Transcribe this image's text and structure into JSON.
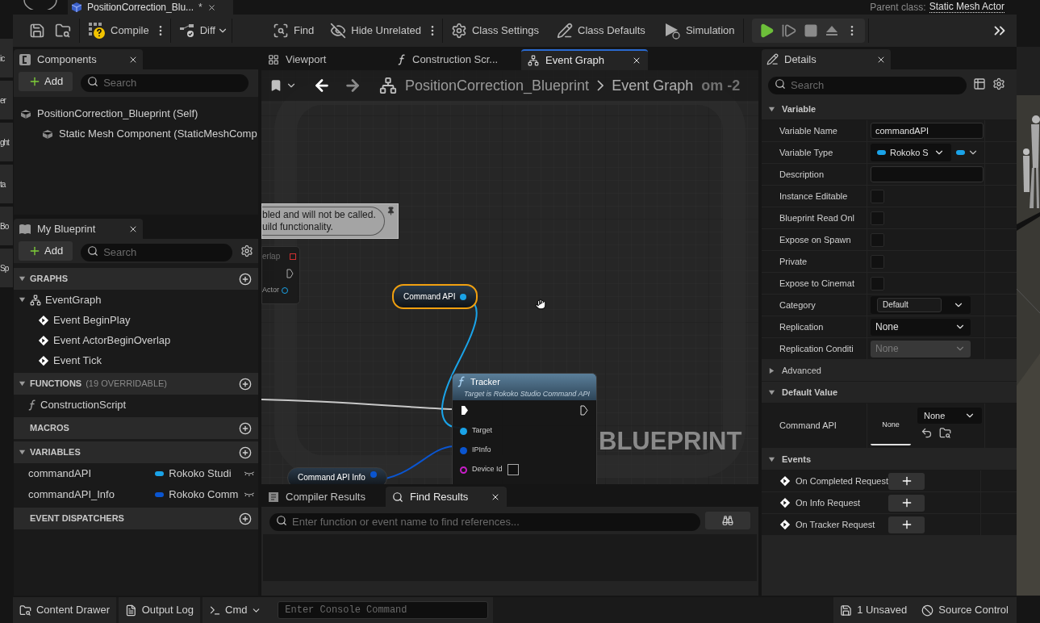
{
  "background_window": {
    "labels": [
      "ic",
      "er",
      "ght",
      "ta",
      "Bo",
      "Sp"
    ]
  },
  "document_tab": {
    "title": "PositionCorrection_Blu...",
    "modified_mark": "*"
  },
  "parent_class": {
    "label": "Parent class:",
    "value": "Static Mesh Actor"
  },
  "toolbar": {
    "compile": "Compile",
    "diff": "Diff",
    "find": "Find",
    "hide_unrelated": "Hide Unrelated",
    "class_settings": "Class Settings",
    "class_defaults": "Class Defaults",
    "simulation": "Simulation"
  },
  "components": {
    "tab": "Components",
    "add": "Add",
    "search_placeholder": "Search",
    "tree": [
      {
        "label": "PositionCorrection_Blueprint (Self)",
        "children": [
          {
            "label": "Static Mesh Component (StaticMeshComp"
          }
        ]
      }
    ]
  },
  "my_blueprint": {
    "tab": "My Blueprint",
    "add": "Add",
    "search_placeholder": "Search",
    "sections": [
      {
        "title": "GRAPHS",
        "expanded": true,
        "items": [
          {
            "kind": "graph",
            "label": "EventGraph",
            "expanded": true,
            "children": [
              {
                "kind": "event",
                "label": "Event BeginPlay"
              },
              {
                "kind": "event",
                "label": "Event ActorBeginOverlap"
              },
              {
                "kind": "event",
                "label": "Event Tick"
              }
            ]
          }
        ]
      },
      {
        "title": "FUNCTIONS",
        "note": "(19 OVERRIDABLE)",
        "expanded": true,
        "items": [
          {
            "kind": "function",
            "label": "ConstructionScript"
          }
        ]
      },
      {
        "title": "MACROS"
      },
      {
        "title": "VARIABLES",
        "expanded": true,
        "items": [
          {
            "kind": "variable",
            "label": "commandAPI",
            "type": "Rokoko Studi",
            "color": "#1aa3e8"
          },
          {
            "kind": "variable",
            "label": "commandAPI_Info",
            "type": "Rokoko Comm",
            "color": "#0a55d0"
          }
        ]
      },
      {
        "title": "EVENT DISPATCHERS"
      }
    ]
  },
  "graph_tabs": [
    {
      "label": "Viewport",
      "kind": "viewport",
      "selected": false
    },
    {
      "label": "Construction Scr...",
      "kind": "function",
      "selected": false
    },
    {
      "label": "Event Graph",
      "kind": "graph",
      "selected": true
    }
  ],
  "breadcrumb": {
    "items": [
      "PositionCorrection_Blueprint",
      "Event Graph"
    ],
    "zoom": "om -2"
  },
  "graph": {
    "comment": {
      "lines": [
        "bled and will not be called.",
        "uild functionality."
      ]
    },
    "overlap_node": {
      "title": "erlap",
      "pin": "Actor"
    },
    "variable_nodes": [
      {
        "label": "Command API",
        "selected": true,
        "color": "#1aa3e8"
      },
      {
        "label": "Command API Info",
        "selected": false,
        "color": "#0a55d0"
      }
    ],
    "function_node": {
      "title": "Tracker",
      "subtitle": "Target is Rokoko Studio Command API",
      "pins": [
        {
          "kind": "object",
          "label": "Target",
          "color": "#1aa3e8"
        },
        {
          "kind": "object",
          "label": "IPInfo",
          "color": "#0a55d0"
        },
        {
          "kind": "checkbox",
          "label": "Device Id",
          "color": "#c81ec8",
          "checked": false
        }
      ]
    },
    "watermark": "BLUEPRINT"
  },
  "bottom_panel": {
    "tabs": [
      {
        "label": "Compiler Results",
        "selected": false
      },
      {
        "label": "Find Results",
        "selected": true
      }
    ],
    "search_placeholder": "Enter function or event name to find references..."
  },
  "details": {
    "tab": "Details",
    "search_placeholder": "Search",
    "sections": [
      {
        "title": "Variable",
        "expanded": true,
        "rows": [
          {
            "kind": "text",
            "label": "Variable Name",
            "value": "commandAPI"
          },
          {
            "kind": "type",
            "label": "Variable Type",
            "value": "Rokoko S",
            "color": "#1aa3e8"
          },
          {
            "kind": "text",
            "label": "Description"
          },
          {
            "kind": "checkbox",
            "label": "Instance Editable",
            "checked": false
          },
          {
            "kind": "checkbox",
            "label": "Blueprint Read Onl",
            "checked": false
          },
          {
            "kind": "checkbox",
            "label": "Expose on Spawn",
            "checked": false
          },
          {
            "kind": "checkbox",
            "label": "Private",
            "checked": false
          },
          {
            "kind": "checkbox",
            "label": "Expose to Cinemat",
            "checked": false
          },
          {
            "kind": "category",
            "label": "Category",
            "value": "Default"
          },
          {
            "kind": "combo",
            "label": "Replication",
            "value": "None",
            "disabled": false
          },
          {
            "kind": "combo",
            "label": "Replication Conditi",
            "value": "None",
            "disabled": true
          }
        ]
      },
      {
        "title": "Advanced",
        "expanded": false
      },
      {
        "title": "Default Value",
        "expanded": true,
        "rows": [
          {
            "kind": "asset",
            "label": "Command API",
            "thumbnail": "None",
            "value": "None"
          }
        ]
      },
      {
        "title": "Events",
        "expanded": true,
        "rows": [
          {
            "kind": "event",
            "label": "On Completed Request"
          },
          {
            "kind": "event",
            "label": "On Info Request"
          },
          {
            "kind": "event",
            "label": "On Tracker Request"
          }
        ]
      }
    ]
  },
  "status_bar": {
    "content_drawer": "Content Drawer",
    "output_log": "Output Log",
    "cmd": "Cmd",
    "console_placeholder": "Enter Console Command",
    "unsaved": "1 Unsaved",
    "source_control": "Source Control"
  }
}
